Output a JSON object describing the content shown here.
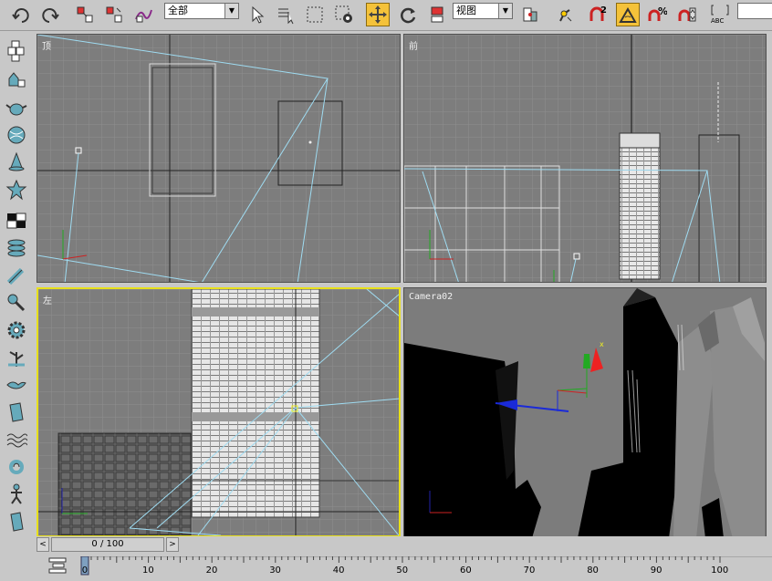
{
  "toolbar": {
    "selection_filter": "全部",
    "coord_system": "视图",
    "icons": [
      "undo-icon",
      "redo-icon",
      "link-icon",
      "unlink-icon",
      "bind-space-warp-icon",
      "select-object-icon",
      "select-by-name-icon",
      "rect-region-icon",
      "window-crossing-icon",
      "select-move-icon",
      "select-rotate-icon",
      "select-scale-icon",
      "use-pivot-icon",
      "select-manipulate-icon",
      "snap-2d-icon",
      "angle-snap-icon",
      "percent-snap-icon",
      "spinner-snap-icon",
      "named-selection-icon"
    ],
    "snap_label": "2",
    "percent_label": "%",
    "abc_label": "ABC"
  },
  "viewports": {
    "top": "顶",
    "front": "前",
    "left": "左",
    "camera": "Camera02"
  },
  "timeline": {
    "frame_display": "0 / 100",
    "ticks": [
      "0",
      "10",
      "20",
      "30",
      "40",
      "50",
      "60",
      "70",
      "80",
      "90",
      "100"
    ]
  }
}
